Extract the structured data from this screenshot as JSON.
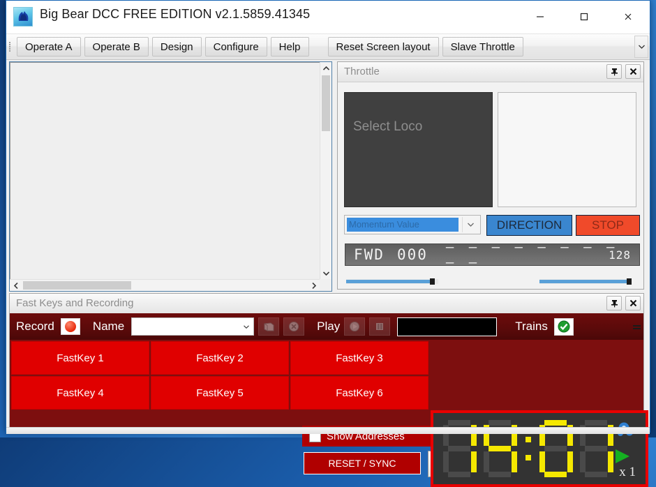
{
  "window": {
    "title": "Big Bear DCC FREE EDITION  v2.1.5859.41345",
    "app_icon": "bear-logo-icon",
    "minimize_label": "—",
    "maximize_label": "□",
    "close_label": "✕"
  },
  "toolbar": {
    "buttons": [
      {
        "label": "Operate A",
        "name": "operate-a"
      },
      {
        "label": "Operate B",
        "name": "operate-b"
      },
      {
        "label": "Design",
        "name": "design"
      },
      {
        "label": "Configure",
        "name": "configure"
      },
      {
        "label": "Help",
        "name": "help"
      }
    ],
    "buttons_right": [
      {
        "label": "Reset Screen layout",
        "name": "reset-screen-layout"
      },
      {
        "label": "Slave Throttle",
        "name": "slave-throttle"
      }
    ],
    "overflow_icon": "chevron-down-icon"
  },
  "canvas": {
    "scroll_up_icon": "chevron-up-icon",
    "scroll_down_icon": "chevron-down-icon",
    "scroll_left_icon": "chevron-left-icon",
    "scroll_right_icon": "chevron-right-icon"
  },
  "throttle": {
    "title": "Throttle",
    "pin_icon": "pin-icon",
    "close_icon": "close-icon",
    "select_loco": "Select Loco",
    "momentum_value": "Momentum Value",
    "momentum_arrow_icon": "chevron-down-icon",
    "direction_label": "DIRECTION",
    "stop_label": "STOP",
    "readout": {
      "direction": "FWD",
      "speed": "000",
      "dashes": "— — — — — — — — — —",
      "max": "128"
    }
  },
  "fastkeys": {
    "title": "Fast Keys and Recording",
    "pin_icon": "pin-icon",
    "close_icon": "close-icon",
    "record_label": "Record",
    "record_icon": "record-dot-icon",
    "name_label": "Name",
    "name_value": "",
    "name_arrow_icon": "chevron-down-icon",
    "save_icon": "save-icon",
    "delete_icon": "delete-x-icon",
    "play_label": "Play",
    "play_icon": "play-icon",
    "pause_icon": "pause-icon",
    "recording_field_value": "",
    "trains_label": "Trains",
    "trains_icon": "green-check-icon",
    "overflow_icon": "chevron-down-double-icon",
    "keys": [
      {
        "label": "FastKey 1"
      },
      {
        "label": "FastKey 2"
      },
      {
        "label": "FastKey 3"
      },
      {
        "label": "FastKey 4"
      },
      {
        "label": "FastKey 5"
      },
      {
        "label": "FastKey 6"
      }
    ],
    "show_addresses_label": "Show Addresses",
    "show_addresses_checked": false,
    "reset_sync_label": "RESET / SYNC"
  },
  "fast_clock": {
    "time": "14:01",
    "hours": "14",
    "minutes": "01",
    "multiplier": "x 1",
    "gear_icon": "gear-icon",
    "play_icon": "play-icon"
  },
  "colors": {
    "accent_red": "#e00000",
    "panel_red": "#7d0f0f",
    "direction_blue": "#3a86cf",
    "stop_orange": "#f04a2a",
    "clock_yellow": "#f5e800",
    "desktop_blue": "#1b5fae"
  }
}
